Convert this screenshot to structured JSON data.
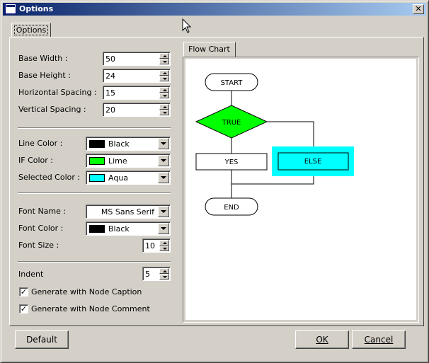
{
  "window": {
    "title": "Options"
  },
  "tabs": {
    "options": "Options",
    "flow_chart": "Flow Chart"
  },
  "spacing": {
    "base_width_label": "Base Width :",
    "base_width_value": "50",
    "base_height_label": "Base Height :",
    "base_height_value": "24",
    "horizontal_label": "Horizontal Spacing :",
    "horizontal_value": "15",
    "vertical_label": "Vertical Spacing :",
    "vertical_value": "20"
  },
  "colors": {
    "line_label": "Line Color :",
    "line_value": "Black",
    "line_swatch": "#000000",
    "if_label": "IF Color :",
    "if_value": "Lime",
    "if_swatch": "#00ff00",
    "selected_label": "Selected Color :",
    "selected_value": "Aqua",
    "selected_swatch": "#00ffff"
  },
  "font": {
    "name_label": "Font Name :",
    "name_value": "MS Sans Serif",
    "color_label": "Font Color :",
    "color_value": "Black",
    "color_swatch": "#000000",
    "size_label": "Font Size :",
    "size_value": "10"
  },
  "misc": {
    "indent_label": "Indent",
    "indent_value": "5",
    "gen_caption_label": "Generate with Node Caption",
    "gen_caption_checked": true,
    "gen_comment_label": "Generate with Node Comment",
    "gen_comment_checked": true
  },
  "flowchart": {
    "start": "START",
    "condition": "TRUE",
    "yes": "YES",
    "else": "ELSE",
    "end": "END"
  },
  "buttons": {
    "default": "Default",
    "ok": "OK",
    "cancel": "Cancel"
  }
}
